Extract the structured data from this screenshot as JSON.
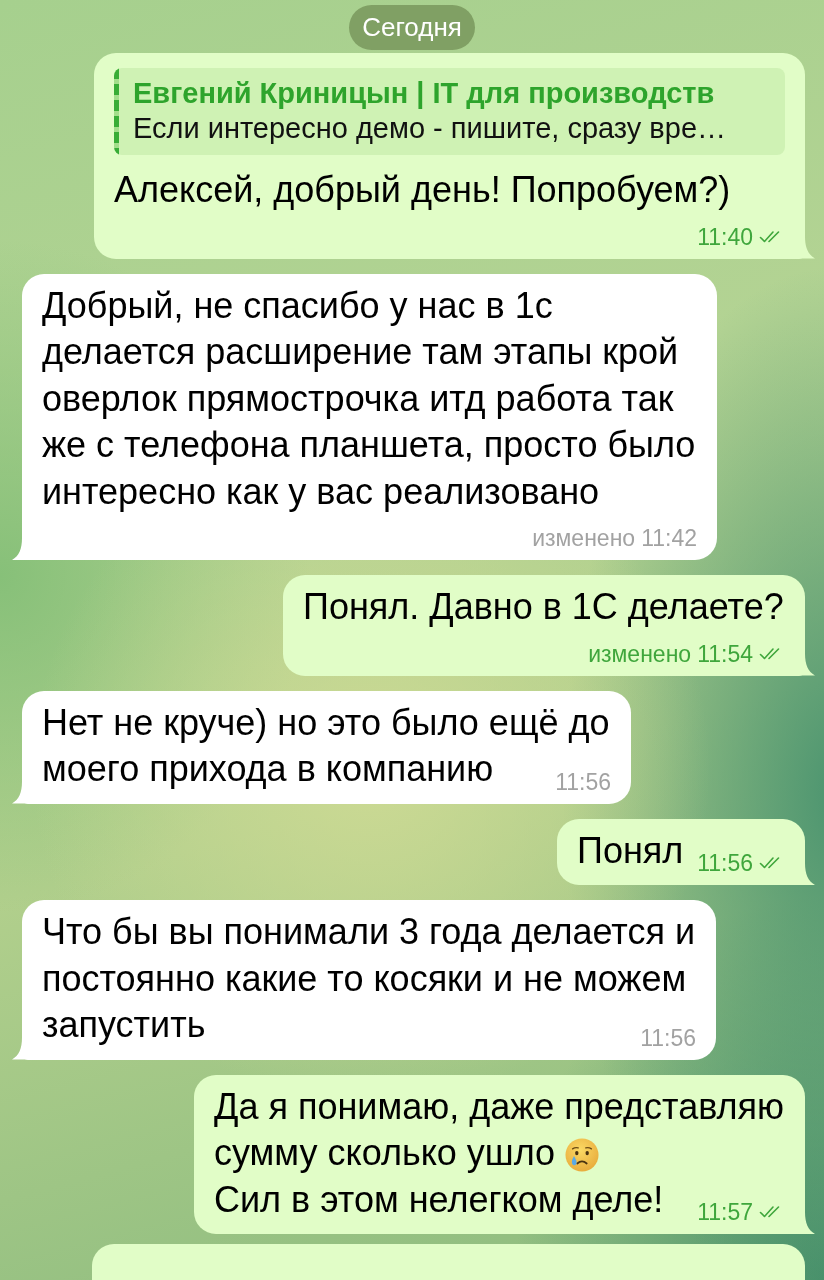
{
  "date_pill": "Сегодня",
  "messages": [
    {
      "kind": "message",
      "outgoing": true,
      "reply": {
        "author": "Евгений Криницын | IT для производств",
        "text": "Если интересно демо - пишите, сразу вре…"
      },
      "lines": [
        {
          "text": "Алексей, добрый день! Попробуем?)"
        }
      ],
      "time": "11:40",
      "read": true
    },
    {
      "kind": "message",
      "outgoing": false,
      "lines": [
        {
          "text": "Добрый, не спасибо у нас в 1с"
        },
        {
          "text": "делается расширение там этапы крой"
        },
        {
          "text": "оверлок прямострочка итд работа так"
        },
        {
          "text": "же с телефона планшета, просто было"
        },
        {
          "text": "интересно как у вас реализовано"
        }
      ],
      "edited": "изменено",
      "time": "11:42"
    },
    {
      "kind": "message",
      "outgoing": true,
      "lines": [
        {
          "text": "Понял. Давно в 1С делаете?"
        }
      ],
      "edited": "изменено",
      "time": "11:54",
      "read": true
    },
    {
      "kind": "message",
      "outgoing": false,
      "lines": [
        {
          "text": "Нет не круче) но это было ещё до"
        },
        {
          "text": "моего прихода в компанию"
        }
      ],
      "time": "11:56"
    },
    {
      "kind": "message",
      "outgoing": true,
      "lines": [
        {
          "text": "Понял"
        }
      ],
      "time": "11:56",
      "read": true
    },
    {
      "kind": "message",
      "outgoing": false,
      "lines": [
        {
          "text": "Что бы вы понимали 3 года делается и"
        },
        {
          "text": "постоянно какие то косяки и не можем"
        },
        {
          "text": "запустить"
        }
      ],
      "time": "11:56"
    },
    {
      "kind": "message",
      "outgoing": true,
      "lines": [
        {
          "text": "Да я понимаю, даже представляю"
        },
        {
          "text": "сумму сколько ушло",
          "trailing_emoji": true
        },
        {
          "text": "Сил в этом нелегком деле!"
        }
      ],
      "time": "11:57",
      "read": true
    },
    {
      "kind": "partial",
      "outgoing": true
    }
  ]
}
